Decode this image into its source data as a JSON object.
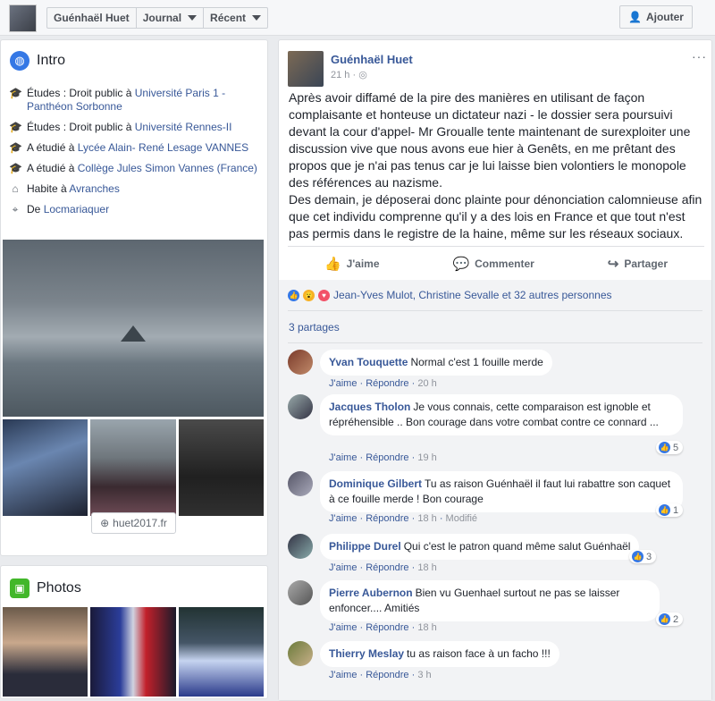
{
  "topbar": {
    "name": "Guénhaël Huet",
    "journal": "Journal",
    "recent": "Récent",
    "add_friend": "Ajouter"
  },
  "intro": {
    "title": "Intro",
    "items": [
      {
        "prefix": "Études : Droit public à ",
        "link": "Université Paris 1 - Panthéon Sorbonne"
      },
      {
        "prefix": "Études : Droit public à ",
        "link": "Université Rennes-II"
      },
      {
        "prefix": "A étudié à ",
        "link": "Lycée Alain- René Lesage VANNES"
      },
      {
        "prefix": "A étudié à ",
        "link": "Collège Jules Simon Vannes (France)"
      },
      {
        "prefix": "Habite à ",
        "link": "Avranches"
      },
      {
        "prefix": "De ",
        "link": "Locmariaquer"
      }
    ],
    "website": "huet2017.fr"
  },
  "photos": {
    "title": "Photos"
  },
  "post": {
    "author": "Guénhaël Huet",
    "time": "21 h",
    "text": "Après avoir diffamé de la pire des manières en utilisant de façon complaisante et honteuse un dictateur nazi - le dossier sera poursuivi devant la cour d'appel- Mr Groualle tente maintenant de surexploiter une discussion vive que nous avons eue hier à Genêts, en me prêtant des propos que je n'ai pas tenus car je lui laisse bien volontiers le monopole des références au nazisme.",
    "text2": "Des demain, je déposerai donc plainte pour dénonciation calomnieuse afin que cet individu comprenne qu'il y a des lois en France et que tout n'est pas permis dans le registre de la haine, même sur les réseaux sociaux.",
    "actions": {
      "like": "J'aime",
      "comment": "Commenter",
      "share": "Partager"
    },
    "reactions": "Jean-Yves Mulot, Christine Sevalle et 32 autres personnes",
    "shares": "3 partages",
    "like_label": "J'aime",
    "reply_label": "Répondre"
  },
  "comments": [
    {
      "name": "Yvan Touquette",
      "text": "Normal c'est 1 fouille merde",
      "time": "20 h",
      "likes": ""
    },
    {
      "name": "Jacques Tholon",
      "text": "Je vous connais, cette comparaison est ignoble et répréhensible .. Bon courage dans votre combat contre ce connard ...",
      "time": "19 h",
      "likes": "5"
    },
    {
      "name": "Dominique Gilbert",
      "text": "Tu as raison Guénhaël il faut lui rabattre son caquet à ce fouille merde ! Bon courage",
      "time": "18 h",
      "extra": "Modifié",
      "likes": "1"
    },
    {
      "name": "Philippe Durel",
      "text": "Qui c'est le patron quand même salut Guénhaël",
      "time": "18 h",
      "likes": "3"
    },
    {
      "name": "Pierre Aubernon",
      "text": "Bien vu Guenhael surtout ne pas se laisser enfoncer.... Amitiés",
      "time": "18 h",
      "likes": "2"
    },
    {
      "name": "Thierry Meslay",
      "text": "tu as raison face à un facho !!!",
      "time": "3 h",
      "likes": ""
    }
  ]
}
